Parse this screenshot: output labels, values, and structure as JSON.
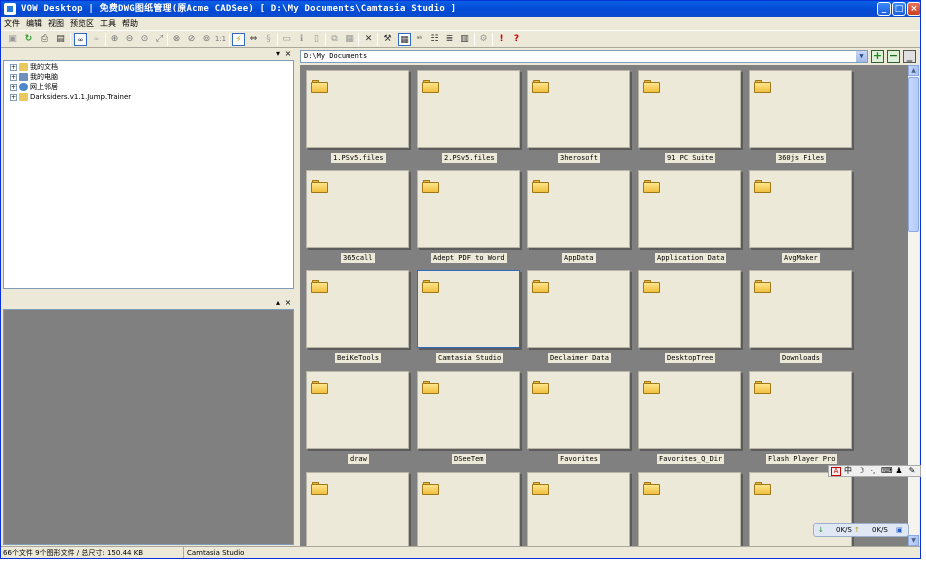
{
  "window": {
    "title": "VOW Desktop | 免费DWG图纸管理(原Acme CADSee) [ D:\\My Documents\\Camtasia Studio ]",
    "buttons": [
      "_",
      "□",
      "×"
    ]
  },
  "menu": [
    "文件",
    "编辑",
    "视图",
    "预览区",
    "工具",
    "帮助"
  ],
  "toolbar": {
    "zoom_label": "1:1",
    "view_label": "∞",
    "info": "!",
    "help": "?"
  },
  "tree": {
    "items": [
      {
        "label": "我的文档",
        "expander": "+",
        "icon_color": "#e8c860"
      },
      {
        "label": "我的电脑",
        "expander": "+",
        "icon_color": "#6f8fbf"
      },
      {
        "label": "网上邻居",
        "expander": "+",
        "icon_color": "#4f88c8"
      },
      {
        "label": "Darksiders.v1.1.Jump.Trainer",
        "expander": "+",
        "icon_color": "#e8c860"
      }
    ]
  },
  "path": {
    "value": "D:\\My Documents",
    "add": "+",
    "remove": "−"
  },
  "thumbnails": [
    [
      "1.PSv5.files",
      "2.PSv5.files",
      "3herosoft",
      "91 PC Suite",
      "360js Files"
    ],
    [
      "365call",
      "Adept PDF to Word",
      "AppData",
      "Application Data",
      "AvgMaker"
    ],
    [
      "BeiKeTools",
      "Camtasia Studio",
      "Declaimer Data",
      "DesktopTree",
      "Downloads"
    ],
    [
      "draw",
      "DSeeTem",
      "Favorites",
      "Favorites_Q_Dir",
      "Flash Player Pro"
    ],
    [
      "",
      "",
      "",
      "",
      ""
    ]
  ],
  "selected": "Camtasia Studio",
  "status": {
    "summary": "66个文件 9个图形文件 / 总尺寸: 150.44 KB",
    "current": "Camtasia Studio"
  },
  "ime": [
    "中",
    "☽",
    "·,",
    "⌨",
    "♟",
    "✎"
  ],
  "netspeed": {
    "down": "0K/S",
    "up": "0K/S"
  },
  "colors": {
    "titlebar": "#0349d2",
    "thumb_bg": "#ece9d8",
    "area_bg": "#808080",
    "selection": "#316ac5"
  }
}
